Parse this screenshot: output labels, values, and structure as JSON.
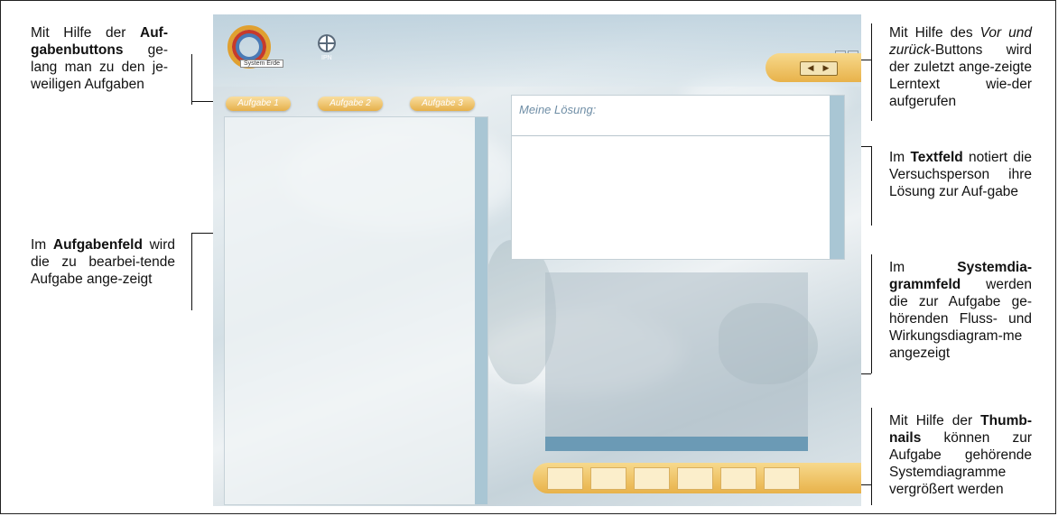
{
  "annotations": {
    "left_top": {
      "p1": "Mit Hilfe der ",
      "b1": "Auf-gabenbuttons",
      "p2": " ge-lang man zu den je-weiligen Aufgaben"
    },
    "left_mid": {
      "p1": "Im ",
      "b1": "Aufgabenfeld",
      "p2": " wird die zu bearbei-tende Aufgabe ange-zeigt"
    },
    "right_top": {
      "p1": "Mit Hilfe des ",
      "i1": "Vor und zurück",
      "p2": "-Buttons wird der zuletzt ange-zeigte Lerntext wie-der aufgerufen"
    },
    "right_text": {
      "p1": "Im ",
      "b1": "Textfeld",
      "p2": " notiert die Versuchsperson ihre Lösung zur Auf-gabe"
    },
    "right_diagram": {
      "p1": "Im ",
      "b1": "Systemdia-grammfeld",
      "p2": " werden die zur Aufgabe ge-hörenden Fluss- und Wirkungsdiagram-me angezeigt"
    },
    "right_thumbs": {
      "p1": "Mit Hilfe der ",
      "b1": "Thumb-nails",
      "p2": " können zur Aufgabe gehörende Systemdiagramme vergrößert werden"
    }
  },
  "app": {
    "logo_label": "System Erde",
    "ipn_label": "IPN",
    "nav": {
      "back": "◀",
      "forward": "▶"
    },
    "tasks": [
      "Aufgabe 1",
      "Aufgabe 2",
      "Aufgabe 3"
    ],
    "solution_title": "Meine Lösung:",
    "thumbnail_count": 6
  },
  "colors": {
    "accent_gold": "#e8b24a",
    "panel_blue": "#a9c6d4",
    "title_blue": "#6f8ea6"
  }
}
